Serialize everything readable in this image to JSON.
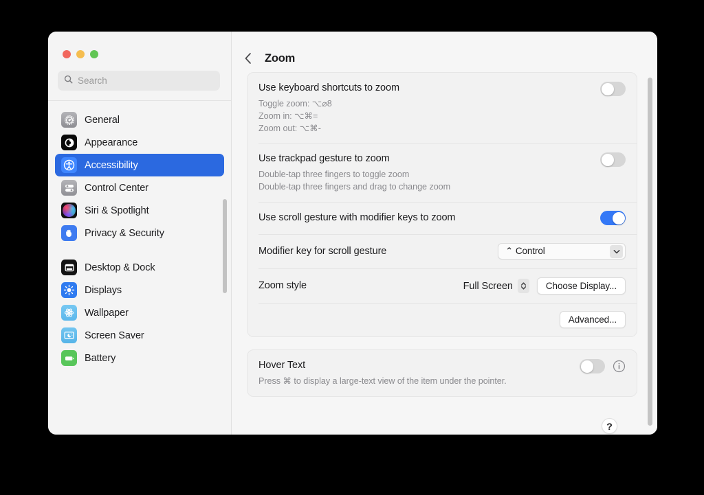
{
  "window": {
    "traffic_lights": [
      "close",
      "minimize",
      "maximize"
    ]
  },
  "sidebar": {
    "search": {
      "placeholder": "Search",
      "value": "",
      "icon": "search-icon"
    },
    "groups": [
      {
        "items": [
          {
            "label": "General",
            "icon": "gear-icon",
            "selected": false
          },
          {
            "label": "Appearance",
            "icon": "appearance-icon",
            "selected": false
          },
          {
            "label": "Accessibility",
            "icon": "accessibility-icon",
            "selected": true
          },
          {
            "label": "Control Center",
            "icon": "control-center-icon",
            "selected": false
          },
          {
            "label": "Siri & Spotlight",
            "icon": "siri-icon",
            "selected": false
          },
          {
            "label": "Privacy & Security",
            "icon": "hand-icon",
            "selected": false
          }
        ]
      },
      {
        "items": [
          {
            "label": "Desktop & Dock",
            "icon": "desktop-dock-icon",
            "selected": false
          },
          {
            "label": "Displays",
            "icon": "brightness-icon",
            "selected": false
          },
          {
            "label": "Wallpaper",
            "icon": "wallpaper-icon",
            "selected": false
          },
          {
            "label": "Screen Saver",
            "icon": "moon-stars-icon",
            "selected": false
          },
          {
            "label": "Battery",
            "icon": "battery-icon",
            "selected": false
          }
        ]
      }
    ]
  },
  "header": {
    "back_icon": "chevron-left-icon",
    "title": "Zoom"
  },
  "main": {
    "zoom_card": {
      "keyboard_shortcuts": {
        "title": "Use keyboard shortcuts to zoom",
        "sub_lines": [
          "Toggle zoom: ⌥⌀8",
          "Zoom in: ⌥⌘=",
          "Zoom out: ⌥⌘-"
        ],
        "toggle_on": false
      },
      "trackpad_gesture": {
        "title": "Use trackpad gesture to zoom",
        "sub_lines": [
          "Double-tap three fingers to toggle zoom",
          "Double-tap three fingers and drag to change zoom"
        ],
        "toggle_on": false
      },
      "scroll_gesture": {
        "title": "Use scroll gesture with modifier keys to zoom",
        "toggle_on": true
      },
      "modifier_key": {
        "title": "Modifier key for scroll gesture",
        "value": "⌃ Control",
        "arrow_icon": "chevron-down-icon"
      },
      "zoom_style": {
        "title": "Zoom style",
        "value": "Full Screen",
        "stepper_icon": "up-down-chevron-icon",
        "choose_display_label": "Choose Display..."
      },
      "advanced_label": "Advanced..."
    },
    "hover_text_card": {
      "title": "Hover Text",
      "sub": "Press ⌘ to display a large-text view of the item under the pointer.",
      "toggle_on": false,
      "info_icon": "info-circle-icon"
    },
    "help_label": "?"
  },
  "colors": {
    "accent": "#3478f6",
    "selected_row": "#2b69e0",
    "window_bg": "#f6f6f6",
    "sidebar_bg": "#f4f4f4",
    "card_bg": "#f2f2f2",
    "secondary_text": "#8a8a8e"
  }
}
